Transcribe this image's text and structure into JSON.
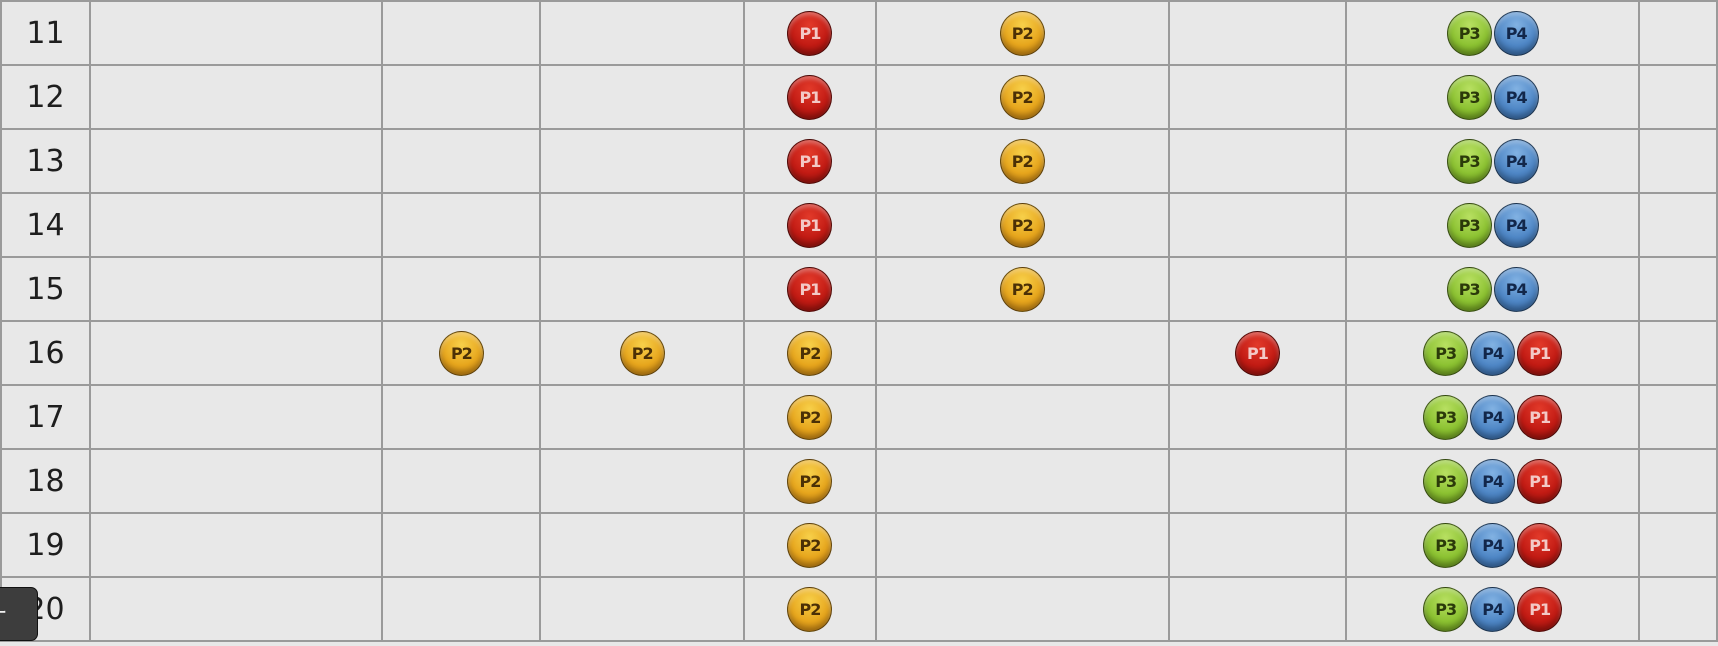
{
  "rows": [
    {
      "label": "11",
      "cells": [
        [],
        [],
        [],
        [
          "P1"
        ],
        [
          "P2"
        ],
        [],
        [
          "P3",
          "P4"
        ],
        []
      ]
    },
    {
      "label": "12",
      "cells": [
        [],
        [],
        [],
        [
          "P1"
        ],
        [
          "P2"
        ],
        [],
        [
          "P3",
          "P4"
        ],
        []
      ]
    },
    {
      "label": "13",
      "cells": [
        [],
        [],
        [],
        [
          "P1"
        ],
        [
          "P2"
        ],
        [],
        [
          "P3",
          "P4"
        ],
        []
      ]
    },
    {
      "label": "14",
      "cells": [
        [],
        [],
        [],
        [
          "P1"
        ],
        [
          "P2"
        ],
        [],
        [
          "P3",
          "P4"
        ],
        []
      ]
    },
    {
      "label": "15",
      "cells": [
        [],
        [],
        [],
        [
          "P1"
        ],
        [
          "P2"
        ],
        [],
        [
          "P3",
          "P4"
        ],
        []
      ]
    },
    {
      "label": "16",
      "cells": [
        [],
        [
          "P2"
        ],
        [
          "P2"
        ],
        [
          "P2"
        ],
        [],
        [
          "P1"
        ],
        [
          "P3",
          "P4",
          "P1"
        ],
        []
      ]
    },
    {
      "label": "17",
      "cells": [
        [],
        [],
        [],
        [
          "P2"
        ],
        [],
        [],
        [
          "P3",
          "P4",
          "P1"
        ],
        []
      ]
    },
    {
      "label": "18",
      "cells": [
        [],
        [],
        [],
        [
          "P2"
        ],
        [],
        [],
        [
          "P3",
          "P4",
          "P1"
        ],
        []
      ]
    },
    {
      "label": "19",
      "cells": [
        [],
        [],
        [],
        [
          "P2"
        ],
        [],
        [],
        [
          "P3",
          "P4",
          "P1"
        ],
        []
      ]
    },
    {
      "label": "20",
      "cells": [
        [],
        [],
        [],
        [
          "P2"
        ],
        [],
        [],
        [
          "P3",
          "P4",
          "P1"
        ],
        []
      ]
    }
  ],
  "player_colors": {
    "P1": "#c21b14",
    "P2": "#e7a61d",
    "P3": "#8cc232",
    "P4": "#4f87c6"
  },
  "tooltip": {
    "text": "ナ"
  }
}
